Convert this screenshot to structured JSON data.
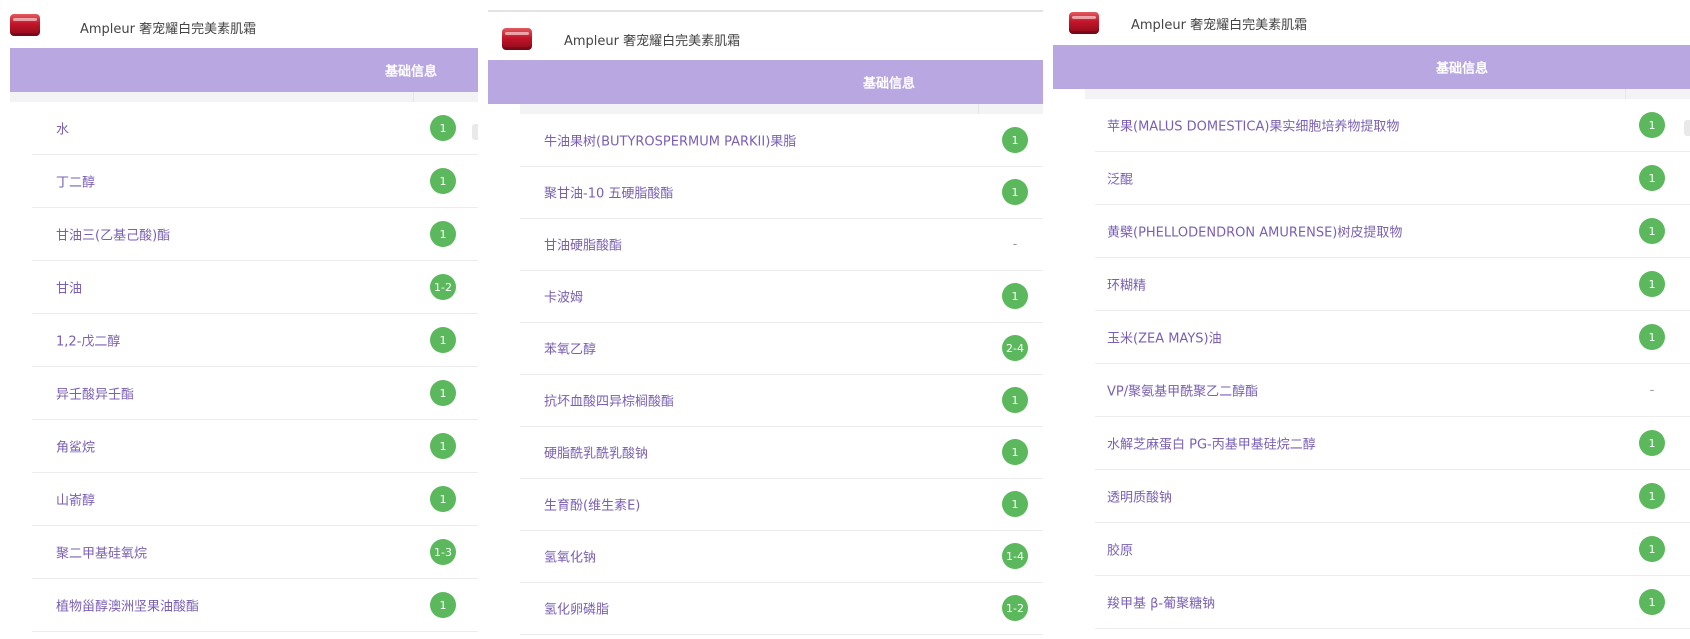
{
  "panels": [
    {
      "product_title": "Ampleur 奢宠耀白完美素肌霜",
      "header_label": "基础信息",
      "ingredients": [
        {
          "name": "水",
          "score": "1"
        },
        {
          "name": "丁二醇",
          "score": "1"
        },
        {
          "name": "甘油三(乙基己酸)酯",
          "score": "1"
        },
        {
          "name": "甘油",
          "score": "1-2"
        },
        {
          "name": "1,2-戊二醇",
          "score": "1"
        },
        {
          "name": "异壬酸异壬酯",
          "score": "1"
        },
        {
          "name": "角鲨烷",
          "score": "1"
        },
        {
          "name": "山嵛醇",
          "score": "1"
        },
        {
          "name": "聚二甲基硅氧烷",
          "score": "1-3"
        },
        {
          "name": "植物甾醇澳洲坚果油酸酯",
          "score": "1"
        }
      ]
    },
    {
      "product_title": "Ampleur 奢宠耀白完美素肌霜",
      "header_label": "基础信息",
      "ingredients": [
        {
          "name": "牛油果树(BUTYROSPERMUM PARKII)果脂",
          "score": "1"
        },
        {
          "name": "聚甘油-10 五硬脂酸酯",
          "score": "1"
        },
        {
          "name": "甘油硬脂酸酯",
          "score": "-"
        },
        {
          "name": "卡波姆",
          "score": "1"
        },
        {
          "name": "苯氧乙醇",
          "score": "2-4"
        },
        {
          "name": "抗坏血酸四异棕榈酸酯",
          "score": "1"
        },
        {
          "name": "硬脂酰乳酰乳酸钠",
          "score": "1"
        },
        {
          "name": "生育酚(维生素E)",
          "score": "1"
        },
        {
          "name": "氢氧化钠",
          "score": "1-4"
        },
        {
          "name": "氢化卵磷脂",
          "score": "1-2"
        }
      ]
    },
    {
      "product_title": "Ampleur 奢宠耀白完美素肌霜",
      "header_label": "基础信息",
      "ingredients": [
        {
          "name": "苹果(MALUS DOMESTICA)果实细胞培养物提取物",
          "score": "1"
        },
        {
          "name": "泛醌",
          "score": "1"
        },
        {
          "name": "黄檗(PHELLODENDRON AMURENSE)树皮提取物",
          "score": "1"
        },
        {
          "name": "环糊精",
          "score": "1"
        },
        {
          "name": "玉米(ZEA MAYS)油",
          "score": "1"
        },
        {
          "name": "VP/聚氨基甲酰聚乙二醇酯",
          "score": "-"
        },
        {
          "name": "水解芝麻蛋白 PG-丙基甲基硅烷二醇",
          "score": "1"
        },
        {
          "name": "透明质酸钠",
          "score": "1"
        },
        {
          "name": "胶原",
          "score": "1"
        },
        {
          "name": "羧甲基 β-葡聚糖钠",
          "score": "1"
        }
      ]
    }
  ]
}
